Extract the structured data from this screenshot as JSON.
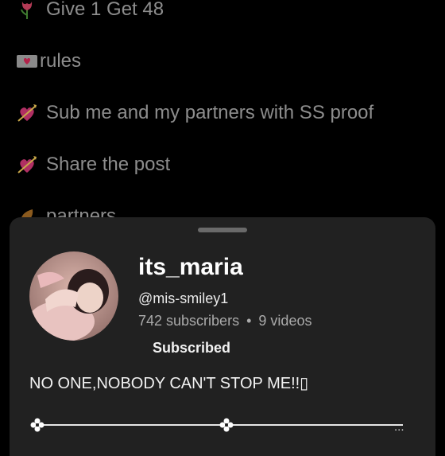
{
  "background_post": {
    "lines": [
      {
        "icon": "tulip-icon",
        "text": "Give 1 Get 48"
      },
      {
        "icon": "love-letter-icon",
        "text": "rules"
      },
      {
        "icon": "heart-arrow-icon",
        "text": "Sub me and my partners with SS proof"
      },
      {
        "icon": "heart-arrow-icon",
        "text": "Share the post"
      },
      {
        "icon": "leaf-icon",
        "text": "partners"
      }
    ]
  },
  "sheet": {
    "channel_name": "its_maria",
    "handle": "@mis-smiley1",
    "subscribers": "742 subscribers",
    "separator": "•",
    "videos": "9 videos",
    "subscribe_button": "Subscribed",
    "description": "NO ONE,NOBODY CAN'T STOP ME!!▯",
    "more": "..."
  },
  "colors": {
    "background": "#000000",
    "sheet": "#212121",
    "background_text": "#8d8d8d",
    "primary_text": "#ffffff",
    "secondary_text": "#aaaaaa"
  }
}
